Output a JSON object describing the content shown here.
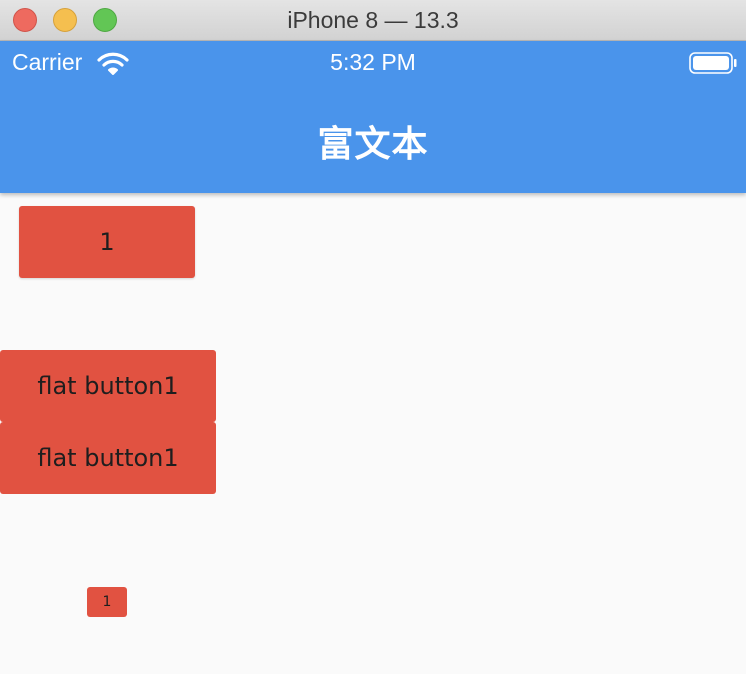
{
  "window": {
    "title": "iPhone 8 — 13.3"
  },
  "status_bar": {
    "carrier": "Carrier",
    "time": "5:32 PM",
    "wifi_icon": "wifi-icon",
    "battery_icon": "battery-icon"
  },
  "nav": {
    "title": "富文本",
    "color": "#4a94eb"
  },
  "buttons": {
    "raised_label": "1",
    "flat_button_1_label": "flat button1",
    "flat_button_2_label": "flat button1",
    "small_label": "1",
    "color": "#e15241"
  }
}
